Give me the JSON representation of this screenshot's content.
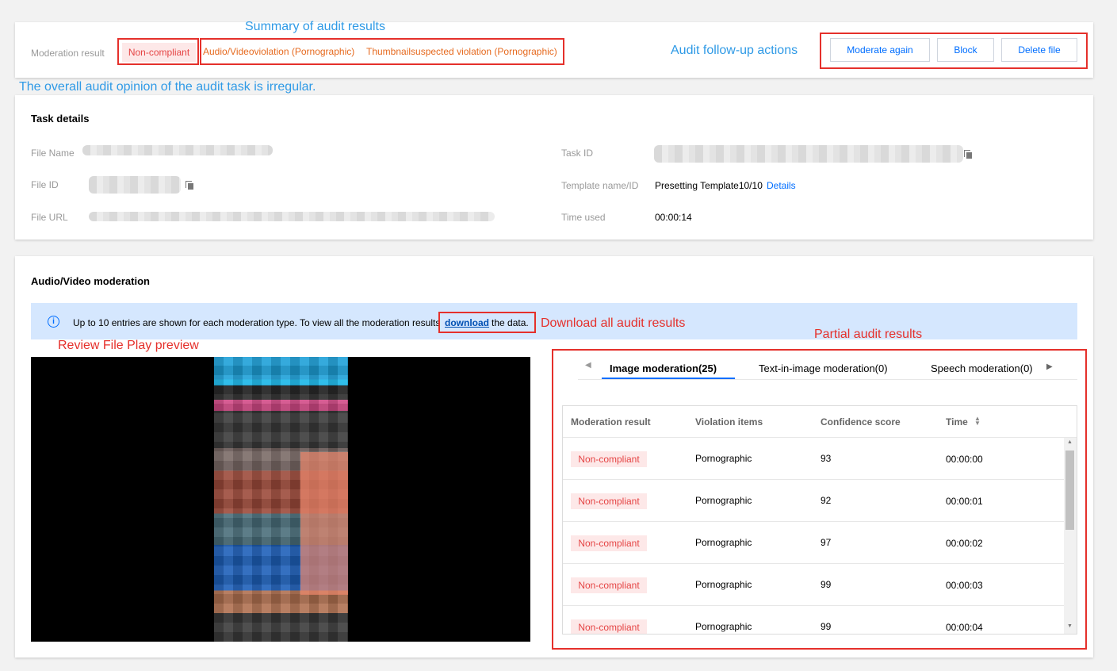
{
  "colors": {
    "accent": "#006eff",
    "annotation_red": "#e5302b",
    "annotation_blue": "#2f9ae6",
    "tag_red_bg": "#fde8e8",
    "tag_red_text": "#e54545",
    "violation_orange": "#e66a1f"
  },
  "annotations": {
    "summary": "Summary of audit results",
    "followup": "Audit follow-up actions",
    "overall": "The overall audit opinion of the audit task is irregular.",
    "download": "Download all audit results",
    "review": "Review File Play preview",
    "partial": "Partial audit results"
  },
  "summary": {
    "label": "Moderation result",
    "status": "Non-compliant",
    "violation_1": "Audio/Videoviolation (Pornographic)",
    "violation_2": "Thumbnailsuspected violation (Pornographic)",
    "actions": [
      "Moderate again",
      "Block",
      "Delete file"
    ]
  },
  "task": {
    "title": "Task details",
    "file_name_label": "File Name",
    "file_id_label": "File ID",
    "file_url_label": "File URL",
    "task_id_label": "Task ID",
    "template_label": "Template name/ID",
    "template_value": "Presetting Template10/10",
    "template_link": "Details",
    "time_used_label": "Time used",
    "time_used_value": "00:00:14"
  },
  "av": {
    "title": "Audio/Video moderation",
    "info_text": "Up to 10 entries are shown for each moderation type. To view all the moderation results",
    "info_link": "download",
    "info_suffix": "the data."
  },
  "tabs": {
    "prev_icon": "chevron-left-icon",
    "next_icon": "chevron-right-icon",
    "items": [
      "Image moderation(25)",
      "Text-in-image moderation(0)",
      "Speech moderation(0)"
    ]
  },
  "table": {
    "headers": [
      "Moderation result",
      "Violation items",
      "Confidence score",
      "Time"
    ],
    "sort_icon": "sort-icon",
    "rows": [
      {
        "result": "Non-compliant",
        "item": "Pornographic",
        "score": "93",
        "time": "00:00:00"
      },
      {
        "result": "Non-compliant",
        "item": "Pornographic",
        "score": "92",
        "time": "00:00:01"
      },
      {
        "result": "Non-compliant",
        "item": "Pornographic",
        "score": "97",
        "time": "00:00:02"
      },
      {
        "result": "Non-compliant",
        "item": "Pornographic",
        "score": "99",
        "time": "00:00:03"
      },
      {
        "result": "Non-compliant",
        "item": "Pornographic",
        "score": "99",
        "time": "00:00:04"
      }
    ]
  }
}
